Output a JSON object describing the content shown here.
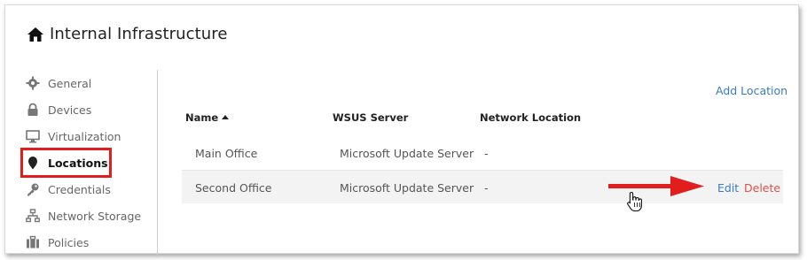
{
  "header": {
    "title": "Internal Infrastructure",
    "icon": "home-icon"
  },
  "sidebar": {
    "items": [
      {
        "label": "General",
        "icon": "gear-icon"
      },
      {
        "label": "Devices",
        "icon": "lock-icon"
      },
      {
        "label": "Virtualization",
        "icon": "monitor-icon"
      },
      {
        "label": "Locations",
        "icon": "map-pin-icon",
        "active": true
      },
      {
        "label": "Credentials",
        "icon": "key-icon"
      },
      {
        "label": "Network Storage",
        "icon": "network-icon"
      },
      {
        "label": "Policies",
        "icon": "briefcase-icon"
      }
    ]
  },
  "main": {
    "add_location_label": "Add Location",
    "table": {
      "columns": [
        "Name",
        "WSUS Server",
        "Network Location"
      ],
      "sort_column": "Name",
      "rows": [
        {
          "name": "Main Office",
          "wsus": "Microsoft Update Server",
          "network": "-"
        },
        {
          "name": "Second Office",
          "wsus": "Microsoft Update Server",
          "network": "-",
          "actions": {
            "edit": "Edit",
            "delete": "Delete"
          }
        }
      ]
    }
  },
  "colors": {
    "accent": "#3b7bbf",
    "danger": "#d9534f",
    "highlight": "#e21d1d"
  }
}
